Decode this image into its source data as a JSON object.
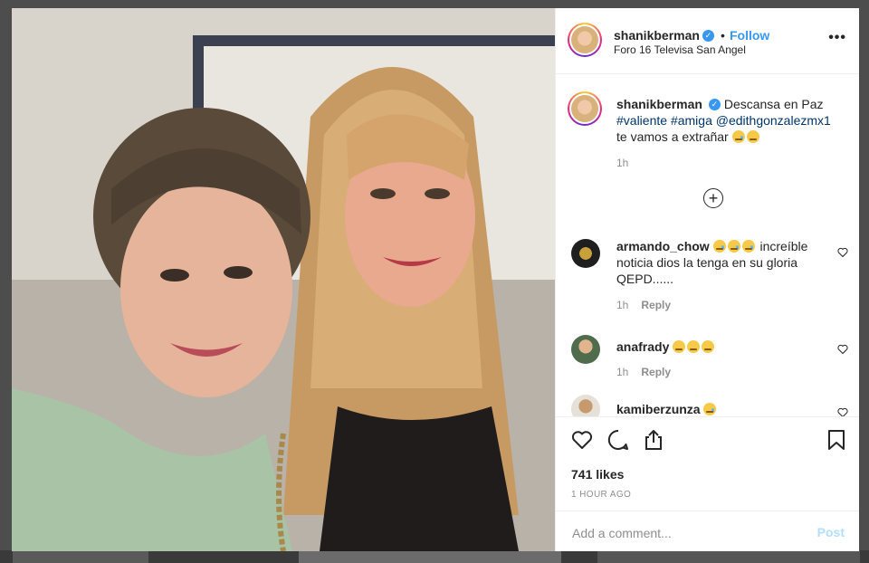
{
  "post": {
    "username": "shanikberman",
    "verified_mark": "✓",
    "separator": "•",
    "follow_label": "Follow",
    "location": "Foro 16 Televisa San Angel",
    "more_label": "•••"
  },
  "caption": {
    "username": "shanikberman",
    "text_1": "Descansa en Paz",
    "hashtag_1": "#valiente",
    "hashtag_2": "#amiga",
    "mention": "@edithgonzalezmx1",
    "text_2": "te vamos a extrañar",
    "time": "1h",
    "load_more": "+"
  },
  "comments": [
    {
      "username": "armando_chow",
      "text": "increíble noticia dios la tenga en su gloria QEPD......",
      "time": "1h",
      "reply": "Reply"
    },
    {
      "username": "anafrady",
      "text": "",
      "time": "1h",
      "reply": "Reply"
    },
    {
      "username": "kamiberzunza",
      "text": ""
    }
  ],
  "likes": "741 likes",
  "timeago": "1 HOUR AGO",
  "add_comment": {
    "placeholder": "Add a comment...",
    "post_label": "Post"
  },
  "colors": {
    "accent": "#3897f0",
    "post_disabled": "#b2dffc",
    "muted": "#8e8e8e"
  },
  "icons": [
    "heart-icon",
    "comment-icon",
    "share-icon",
    "bookmark-icon",
    "verified-badge-icon",
    "more-options-icon",
    "load-more-comments-icon"
  ]
}
